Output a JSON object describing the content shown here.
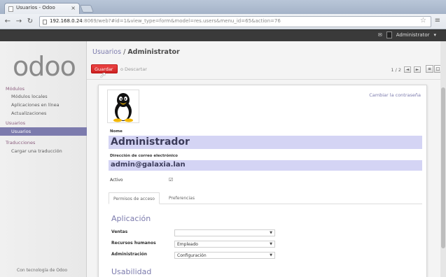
{
  "browser": {
    "tab_title": "Usuarios - Odoo",
    "tab_close": "×",
    "url_host": "192.168.0.24",
    "url_path": ":8069/web?#id=1&view_type=form&model=res.users&menu_id=65&action=76",
    "star": "☆",
    "menu": "≡"
  },
  "topbar": {
    "user_name": "Administrator"
  },
  "sidebar": {
    "logo": "odoo",
    "sections": [
      {
        "label": "Módulos",
        "items": [
          {
            "label": "Módulos locales",
            "active": false
          },
          {
            "label": "Aplicaciones en línea",
            "active": false
          },
          {
            "label": "Actualizaciones",
            "active": false
          }
        ]
      },
      {
        "label": "Usuarios",
        "items": [
          {
            "label": "Usuarios",
            "active": true
          }
        ]
      },
      {
        "label": "Traducciones",
        "items": [
          {
            "label": "Cargar una traducción",
            "active": false
          }
        ]
      }
    ],
    "powered_by": "Con tecnología de Odoo"
  },
  "main": {
    "breadcrumb_parent": "Usuarios",
    "breadcrumb_sep": "/",
    "breadcrumb_current": "Administrator",
    "save_label": "Guardar",
    "discard_label": "o Descartar",
    "pager_text": "1 / 2",
    "pager_prev": "◄",
    "pager_next": "►",
    "view_list": "≡",
    "view_form": "□"
  },
  "form": {
    "change_password": "Cambiar la contraseña",
    "name_label": "Nome",
    "name_value": "Administrador",
    "email_label": "Dirección de correo electrónico",
    "email_value": "admin@galaxia.lan",
    "active_label": "Activo",
    "active_checked": "☑",
    "tabs": [
      "Permisos de acceso",
      "Preferencias"
    ],
    "section_application": "Aplicación",
    "rows": [
      {
        "label": "Ventas",
        "value": ""
      },
      {
        "label": "Recursos humanos",
        "value": "Empleado"
      },
      {
        "label": "Administración",
        "value": "Configuración"
      }
    ],
    "section_usability": "Usabilidad"
  },
  "colors": {
    "accent": "#7c7bad",
    "save_button": "#d33333",
    "field_highlight": "#d4d4f4"
  }
}
